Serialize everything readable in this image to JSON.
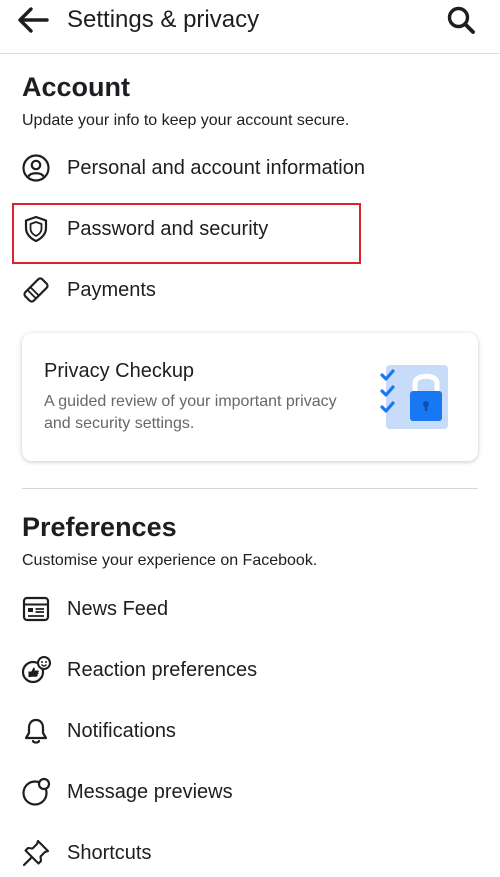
{
  "header": {
    "title": "Settings & privacy",
    "back_icon": "arrow-left-icon",
    "search_icon": "search-icon"
  },
  "account": {
    "title": "Account",
    "subtitle": "Update your info to keep your account secure.",
    "items": [
      {
        "label": "Personal and account information",
        "icon": "user-circle-icon"
      },
      {
        "label": "Password and security",
        "icon": "shield-icon",
        "highlighted": true
      },
      {
        "label": "Payments",
        "icon": "tag-icon"
      }
    ]
  },
  "privacy_card": {
    "title": "Privacy Checkup",
    "description": "A guided review of your important privacy and security settings.",
    "illustration": "padlock-checklist-icon"
  },
  "preferences": {
    "title": "Preferences",
    "subtitle": "Customise your experience on Facebook.",
    "items": [
      {
        "label": "News Feed",
        "icon": "news-feed-icon"
      },
      {
        "label": "Reaction preferences",
        "icon": "reaction-icon"
      },
      {
        "label": "Notifications",
        "icon": "bell-icon"
      },
      {
        "label": "Message previews",
        "icon": "message-preview-icon"
      },
      {
        "label": "Shortcuts",
        "icon": "pin-icon"
      }
    ]
  },
  "colors": {
    "highlight_border": "#d9232f",
    "accent_blue": "#1877f2",
    "illustration_light_blue": "#a9c8f5"
  }
}
